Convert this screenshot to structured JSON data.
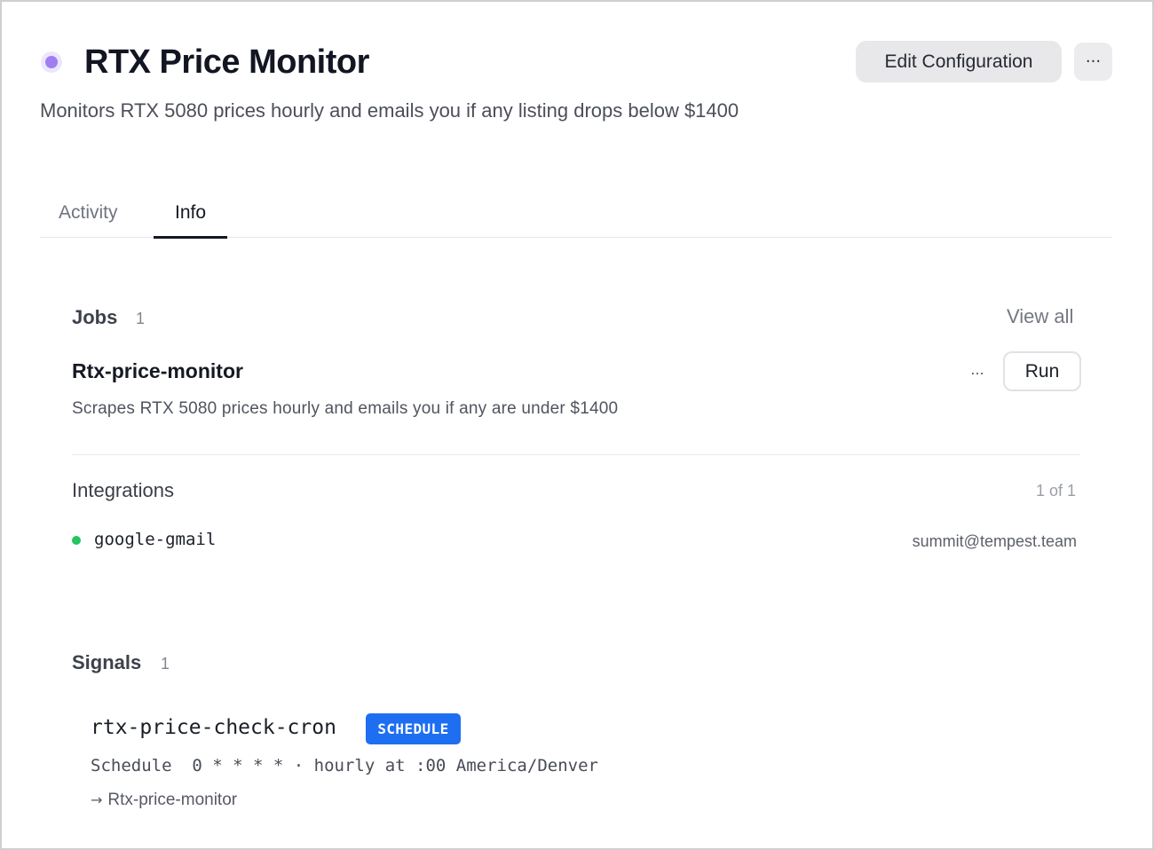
{
  "header": {
    "title": "RTX Price Monitor",
    "description": "Monitors RTX 5080 prices hourly and emails you if any listing drops below $1400",
    "edit_label": "Edit Configuration",
    "more_label": "···",
    "status_color": "#a07df0"
  },
  "tabs": [
    {
      "label": "Activity",
      "active": false
    },
    {
      "label": "Info",
      "active": true
    }
  ],
  "jobs": {
    "title": "Jobs",
    "count": "1",
    "view_all": "View all",
    "items": [
      {
        "name": "Rtx-price-monitor",
        "description": "Scrapes RTX 5080 prices hourly and emails you if any are under $1400",
        "more_label": "...",
        "run_label": "Run"
      }
    ]
  },
  "integrations": {
    "title": "Integrations",
    "count": "1 of 1",
    "items": [
      {
        "name": "google-gmail",
        "account": "summit@tempest.team",
        "status_color": "#22c55e"
      }
    ]
  },
  "signals": {
    "title": "Signals",
    "count": "1",
    "items": [
      {
        "name": "rtx-price-check-cron",
        "badge": "SCHEDULE",
        "badge_color": "#1e6ef2",
        "schedule": "Schedule  0 * * * * · hourly at :00 America/Denver",
        "arrow": "→",
        "target": "Rtx-price-monitor"
      }
    ]
  }
}
